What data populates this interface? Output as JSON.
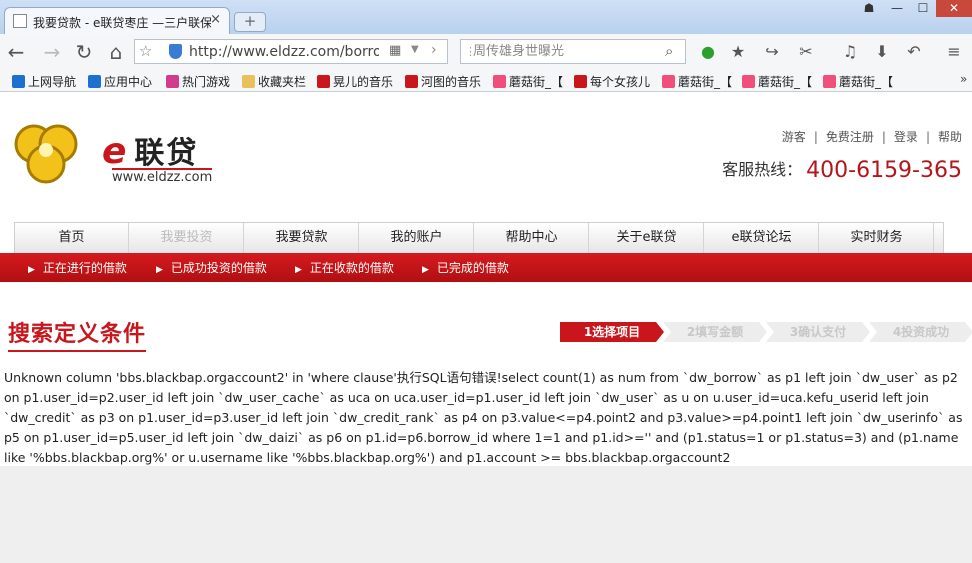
{
  "browser": {
    "tab_title": "我要贷款 - e联贷枣庄 —三户联保",
    "tab_close": "×",
    "new_tab": "+",
    "win_buttons": {
      "menu": "☗",
      "min": "—",
      "max": "☐",
      "close": "✕"
    },
    "address_url": "http://www.eldzz.com/borrow",
    "search_placeholder": "周传雄身世曝光",
    "bookmarks": [
      {
        "label": "上网导航",
        "color": "#1e6fd0"
      },
      {
        "label": "应用中心",
        "color": "#1e6fd0"
      },
      {
        "label": "热门游戏",
        "color": "#d23c8c"
      },
      {
        "label": "收藏夹栏",
        "color": "#e8c15a"
      },
      {
        "label": "晃儿的音乐",
        "color": "#c9161d"
      },
      {
        "label": "河图的音乐",
        "color": "#c9161d"
      },
      {
        "label": "蘑菇街_【",
        "color": "#ef4f7a"
      },
      {
        "label": "每个女孩儿",
        "color": "#c9161d"
      },
      {
        "label": "蘑菇街_【",
        "color": "#ef4f7a"
      },
      {
        "label": "蘑菇街_【",
        "color": "#ef4f7a"
      },
      {
        "label": "蘑菇街_【",
        "color": "#ef4f7a"
      }
    ],
    "bookmark_more": "»"
  },
  "site": {
    "logo_brand": "联贷",
    "logo_e": "e",
    "logo_url": "www.eldzz.com",
    "top_links": [
      "游客",
      "免费注册",
      "登录",
      "帮助"
    ],
    "hotline_label": "客服热线：",
    "hotline_number": "400-6159-365",
    "nav": [
      "首页",
      "我要投资",
      "我要贷款",
      "我的账户",
      "帮助中心",
      "关于e联贷",
      "e联贷论坛",
      "实时财务"
    ],
    "active_nav_index": 1,
    "subnav": [
      "正在进行的借款",
      "已成功投资的借款",
      "正在收款的借款",
      "已完成的借款"
    ],
    "section_title": "搜索定义条件",
    "steps": [
      "1选择项目",
      "2填写金额",
      "3确认支付",
      "4投资成功"
    ],
    "active_step_index": 0,
    "error_text": "Unknown column 'bbs.blackbap.orgaccount2' in 'where clause'执行SQL语句错误!select count(1) as num from `dw_borrow` as p1 left join `dw_user` as p2 on p1.user_id=p2.user_id left join `dw_user_cache` as uca on uca.user_id=p1.user_id left join `dw_user` as u on u.user_id=uca.kefu_userid left join `dw_credit` as p3 on p1.user_id=p3.user_id left join `dw_credit_rank` as p4 on p3.value<=p4.point2 and p3.value>=p4.point1 left join `dw_userinfo` as p5 on p1.user_id=p5.user_id left join `dw_daizi` as p6 on p1.id=p6.borrow_id where 1=1 and p1.id>='' and (p1.status=1 or p1.status=3) and (p1.name like '%bbs.blackbap.org%' or u.username like '%bbs.blackbap.org%') and p1.account >= bbs.blackbap.orgaccount2"
  },
  "colors": {
    "brand_red": "#c9161d",
    "step_active": "#c9161d",
    "step_inactive": "#ededed"
  }
}
